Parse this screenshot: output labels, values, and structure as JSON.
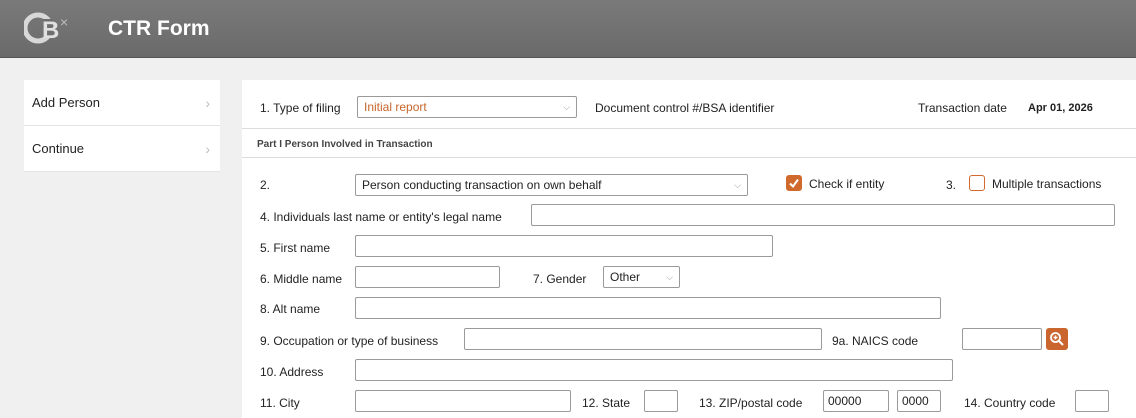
{
  "header": {
    "title": "CTR Form",
    "logo_icon": "cbx-logo"
  },
  "sidebar": {
    "items": [
      {
        "label": "Add Person"
      },
      {
        "label": "Continue"
      }
    ]
  },
  "form": {
    "type_of_filing_label": "1. Type of filing",
    "type_of_filing_value": "Initial report",
    "doc_control_label": "Document control #/BSA identifier",
    "transaction_date_label": "Transaction date",
    "transaction_date_value": "Apr 01, 2026",
    "section_title": "Part I Person Involved in Transaction",
    "field2_label": "2.",
    "field2_value": "Person conducting transaction on own behalf",
    "check_entity_label": "Check if entity",
    "field3_label": "3.",
    "multiple_transactions_label": "Multiple transactions",
    "last_name_label": "4. Individuals last name or entity's legal name",
    "last_name_value": "",
    "first_name_label": "5. First name",
    "first_name_value": "",
    "middle_name_label": "6. Middle name",
    "middle_name_value": "",
    "gender_label": "7. Gender",
    "gender_value": "Other",
    "alt_name_label": "8. Alt name",
    "alt_name_value": "",
    "occupation_label": "9. Occupation or type of business",
    "occupation_value": "",
    "naics_label": "9a. NAICS code",
    "naics_value": "",
    "address_label": "10. Address",
    "address_value": "",
    "city_label": "11. City",
    "city_value": "",
    "state_label": "12. State",
    "state_value": "",
    "zip_label": "13. ZIP/postal code",
    "zip_value": "00000",
    "zip4_value": "0000",
    "country_label": "14. Country code",
    "country_value": ""
  },
  "colors": {
    "accent": "#d06a2c",
    "header_bg": "#6e6e6e"
  }
}
